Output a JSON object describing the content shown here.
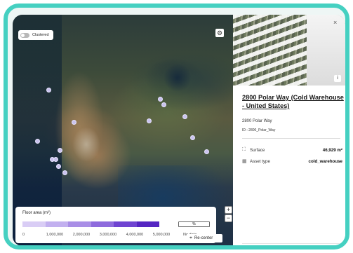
{
  "map": {
    "cluster_toggle_label": "Clustered",
    "clustered": false,
    "zoom_in": "+",
    "zoom_out": "−",
    "recenter_label": "Re-center",
    "attribution": "mapbox"
  },
  "legend": {
    "title": "Floor area (m²)",
    "colors": [
      "#d9cdf5",
      "#c2b0ef",
      "#a98ee6",
      "#8e6bdd",
      "#6f44d1",
      "#5526c2"
    ],
    "ticks": [
      "0",
      "1,000,000",
      "2,000,000",
      "3,000,000",
      "4,000,000",
      "5,000,000"
    ],
    "no_data_label": "No data",
    "no_data_box": "%"
  },
  "panel": {
    "close": "×",
    "info": "i",
    "title": "2800 Polar Way (Cold Warehouse - United States)",
    "address": "2800 Polar Way",
    "id_line": "ID : 2800_Polar_Way",
    "surface_label": "Surface",
    "surface_value": "46,929 m²",
    "asset_type_label": "Asset type",
    "asset_type_value": "cold_warehouse"
  }
}
